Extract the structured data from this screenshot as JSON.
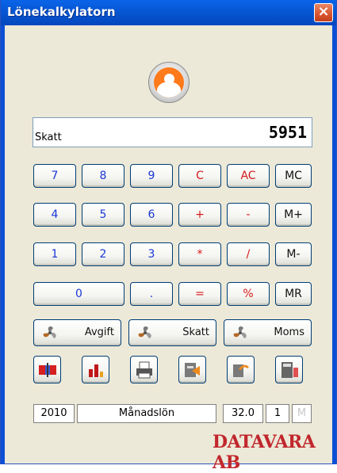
{
  "window": {
    "title": "Lönekalkylatorn",
    "close_symbol": "×"
  },
  "display": {
    "label": "Skatt",
    "value": "5951"
  },
  "keypad": {
    "row1": [
      "7",
      "8",
      "9",
      "C",
      "AC",
      "MC"
    ],
    "row2": [
      "4",
      "5",
      "6",
      "+",
      "-",
      "M+"
    ],
    "row3": [
      "1",
      "2",
      "3",
      "*",
      "/",
      "M-"
    ],
    "row4": [
      "0",
      ".",
      "=",
      "%",
      "MR"
    ]
  },
  "functions": {
    "avgift": "Avgift",
    "skatt": "Skatt",
    "moms": "Moms"
  },
  "toolbar": {
    "icons": [
      "flag-icon",
      "bar-chart-icon",
      "printer-icon",
      "export-icon",
      "undo-icon",
      "calculator-icon"
    ]
  },
  "status": {
    "year": "2010",
    "period": "Månadslön",
    "rate": "32.0",
    "count": "1",
    "memory": "M"
  },
  "brand": {
    "text": "DATAVARA AB",
    "color": "#c1272d"
  },
  "colors": {
    "digit": "#1a38d6",
    "operator": "#d41a1a",
    "memory": "#111111",
    "titlebar": "#0758d6"
  }
}
